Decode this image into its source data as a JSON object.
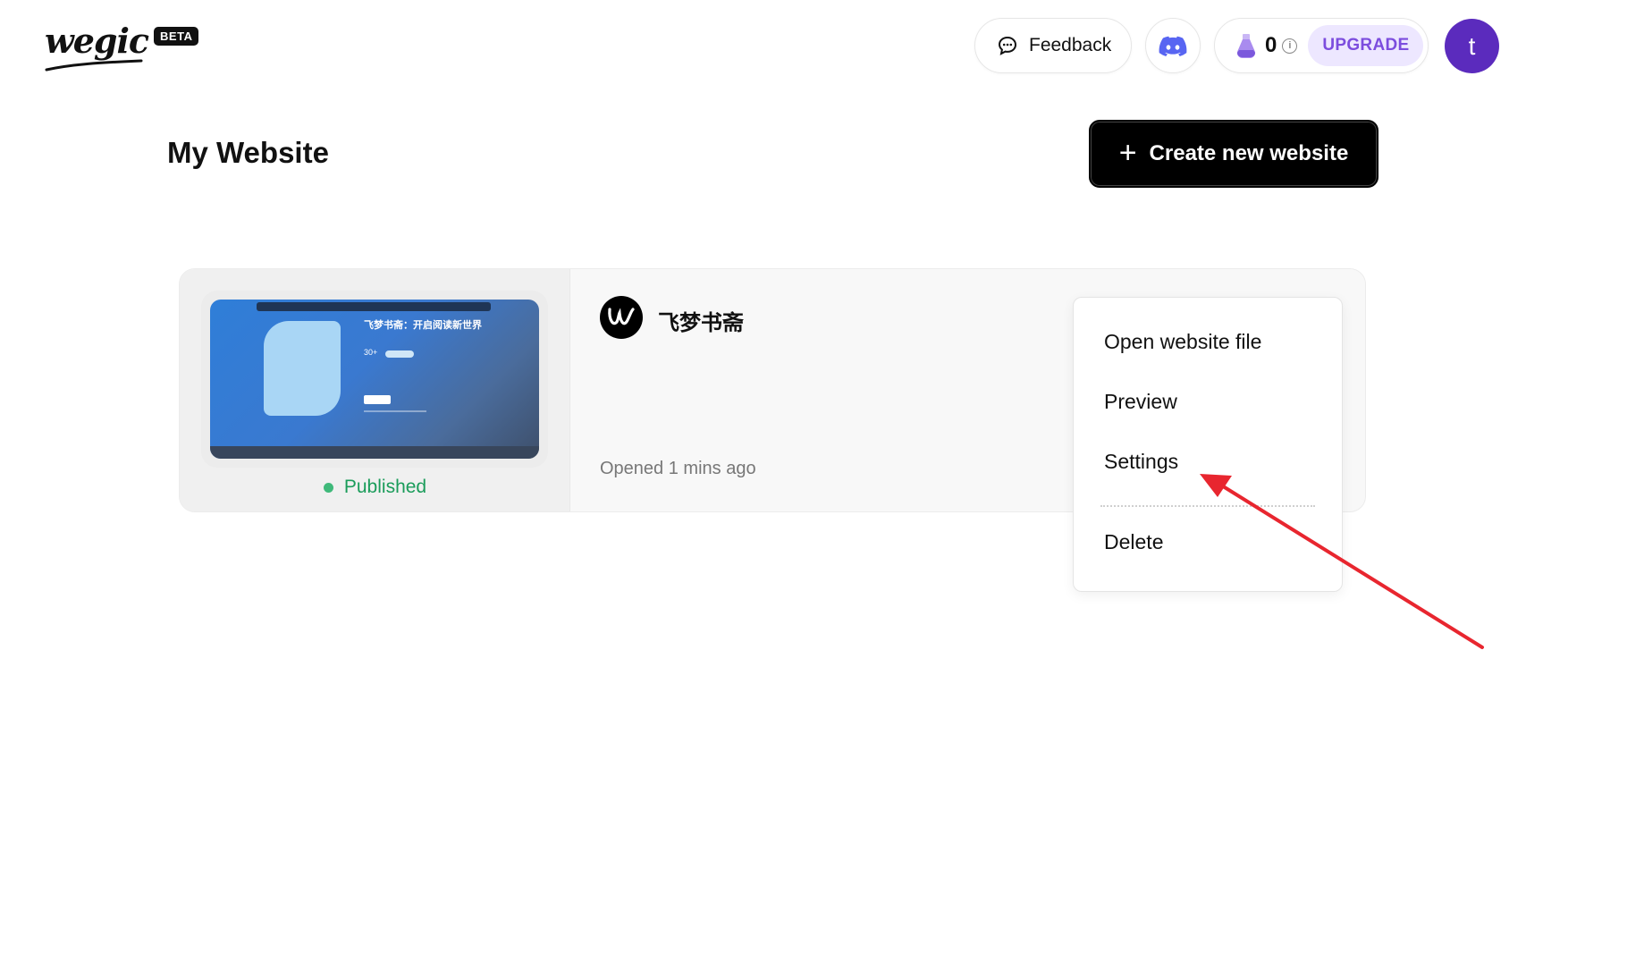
{
  "header": {
    "logo_text": "wegic",
    "beta_label": "BETA",
    "feedback_label": "Feedback",
    "feedback_icon": "chat-bubble-icon",
    "discord_icon": "discord-icon",
    "credits": {
      "icon": "potion-flask-icon",
      "count": "0",
      "info_icon": "info-icon",
      "upgrade_label": "UPGRADE"
    },
    "avatar_initial": "t"
  },
  "main": {
    "title": "My Website",
    "create_button_label": "Create new website",
    "create_button_icon": "plus-icon"
  },
  "website_card": {
    "name": "飞梦书斋",
    "status": "Published",
    "opened": "Opened 1 mins ago",
    "thumbnail": {
      "headline": "飞梦书斋：开启阅读新世界",
      "stat": "30+"
    }
  },
  "context_menu": {
    "items": [
      "Open website file",
      "Preview",
      "Settings",
      "Delete"
    ]
  },
  "colors": {
    "brand_purple": "#5b2bbd",
    "upgrade_bg": "#ede7ff",
    "upgrade_text": "#7c4dde",
    "published_green": "#1a9c5a",
    "annotation_arrow": "#e8262f"
  }
}
